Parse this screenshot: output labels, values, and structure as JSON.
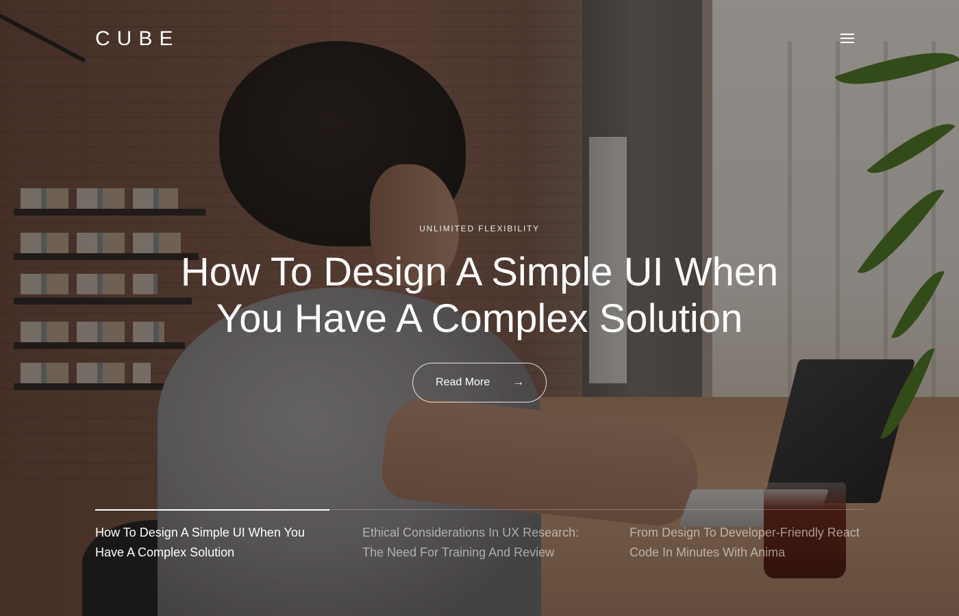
{
  "brand": {
    "logo_text": "CUBE"
  },
  "header": {
    "menu_icon": "hamburger-menu-icon"
  },
  "hero": {
    "eyebrow": "UNLIMITED FLEXIBILITY",
    "title": "How To Design A Simple UI When You Have A Complex Solution",
    "cta_label": "Read More",
    "cta_icon": "arrow-right-icon"
  },
  "slider": {
    "progress": 0.305,
    "active_index": 0,
    "slides": [
      {
        "title": "How To Design A Simple UI When You Have A Complex Solution"
      },
      {
        "title": "Ethical Considerations In UX Research: The Need For Training And Review"
      },
      {
        "title": "From Design To Developer-Friendly React Code In Minutes With Anima"
      }
    ]
  },
  "colors": {
    "text": "#ffffff",
    "overlay": "#14100e"
  }
}
